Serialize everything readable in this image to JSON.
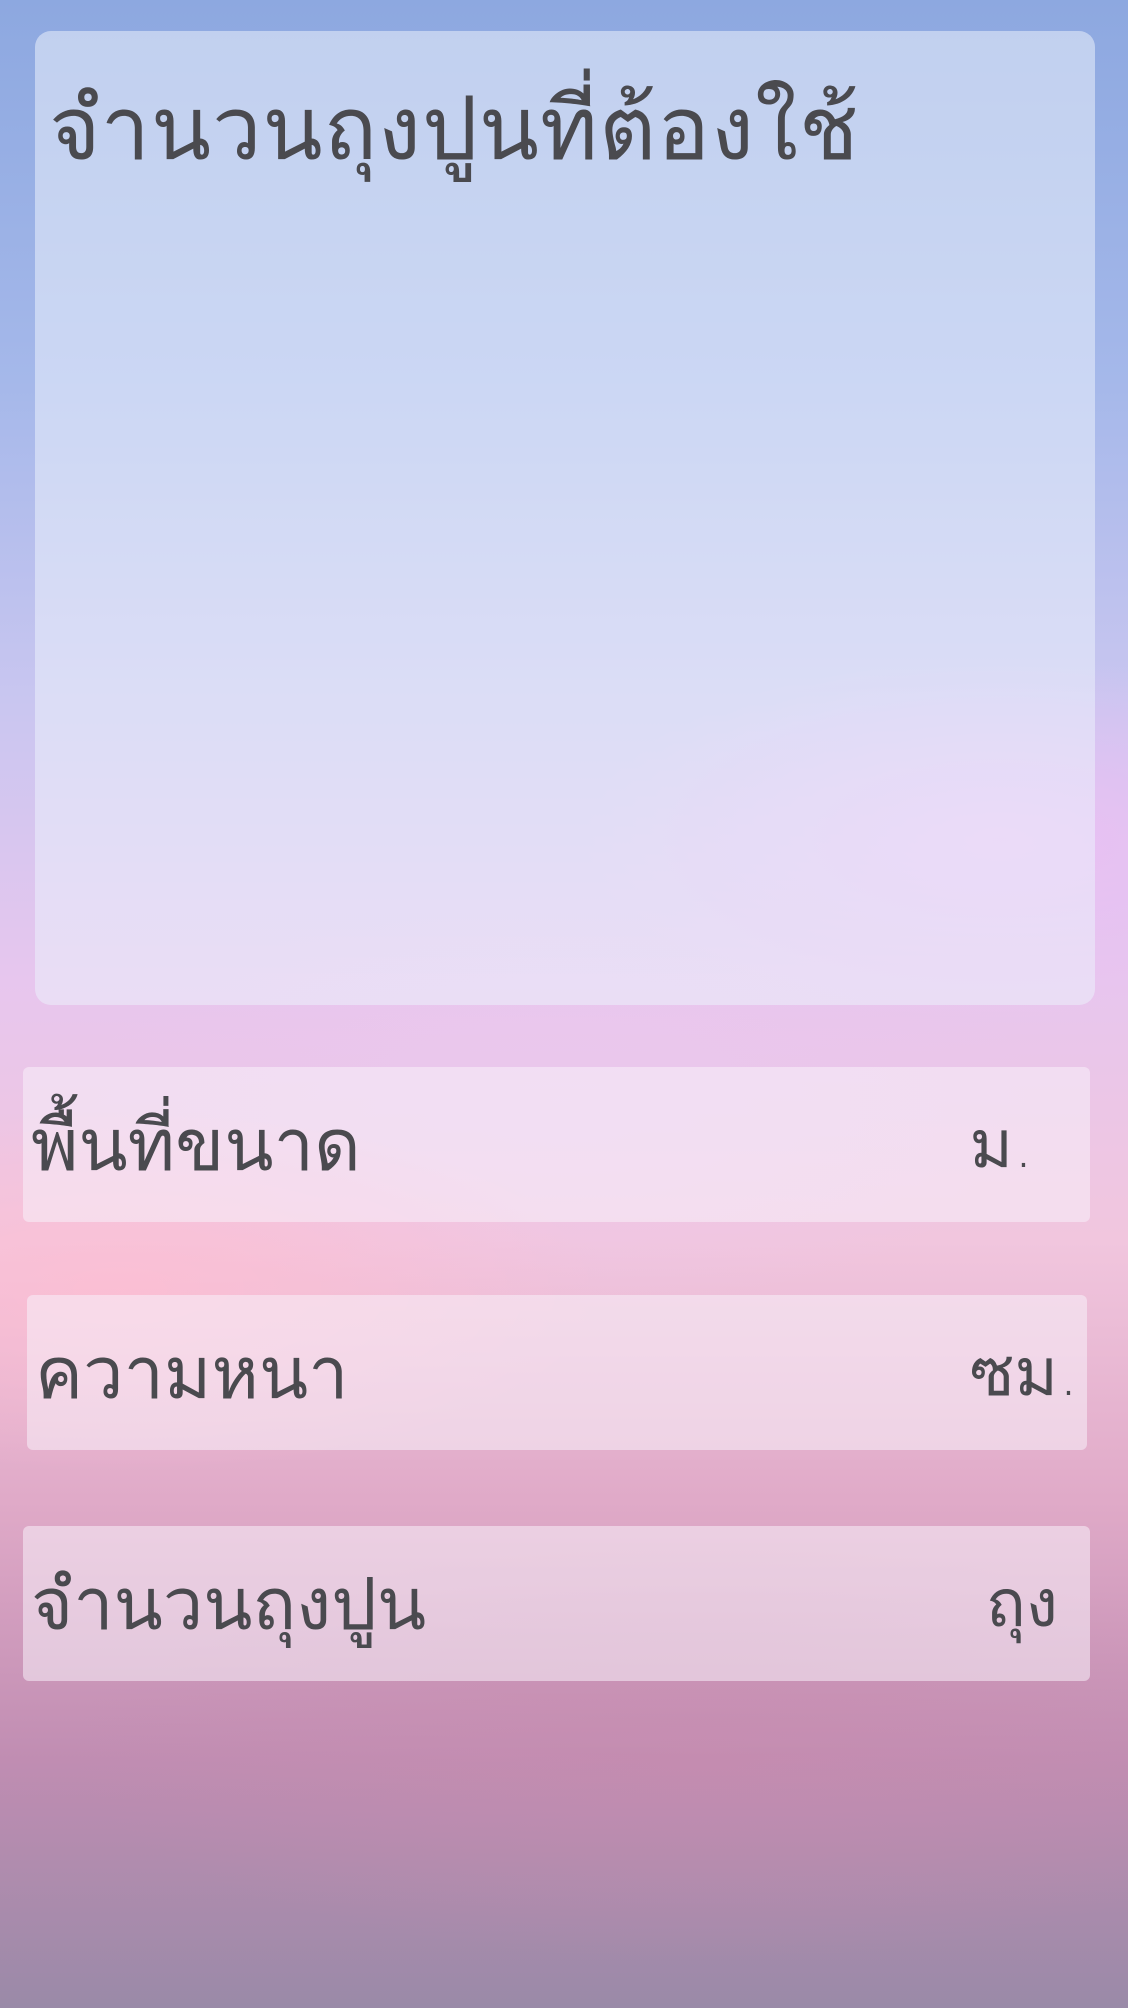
{
  "display": {
    "title": "จำนวนถุงปูนที่ต้องใช้"
  },
  "fields": [
    {
      "label": "พื้นที่ขนาด",
      "unit": "ม."
    },
    {
      "label": "ความหนา",
      "unit": "ซม."
    },
    {
      "label": "จำนวนถุงปูน",
      "unit": "ถุง"
    }
  ]
}
